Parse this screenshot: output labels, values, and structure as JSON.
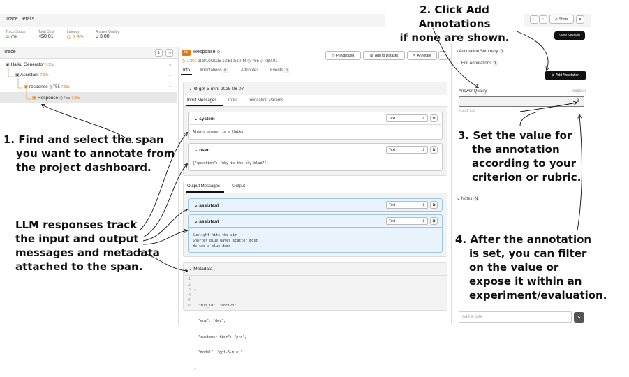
{
  "header": {
    "title": "Trace Details",
    "view_session": "View Session",
    "share": "Share",
    "metrics": [
      {
        "label": "Trace Status",
        "value": "OK"
      },
      {
        "label": "Total Cost",
        "value": "<$0.01"
      },
      {
        "label": "Latency",
        "value": "7.95s"
      },
      {
        "label": "Answer Quality",
        "value": "μ 3.00"
      }
    ]
  },
  "trace": {
    "title": "Trace",
    "nodes": [
      {
        "label": "Haiku Generator",
        "time": "7.95s"
      },
      {
        "label": "Assistant",
        "time": "7.94s"
      },
      {
        "label": "response",
        "tokens": "755",
        "time": "7.93s"
      },
      {
        "label": "Response",
        "tokens": "755",
        "time": "7.30s"
      }
    ]
  },
  "detail": {
    "kind": "llm",
    "title": "Response",
    "time": "7.30s",
    "date": "at 8/10/2025 12:51:51 PM",
    "tokens": "755",
    "cost": "<$0.01",
    "buttons": {
      "playground": "Playground",
      "dataset": "Add to Dataset",
      "annotate": "Annotate"
    },
    "tabs": [
      {
        "label": "Info"
      },
      {
        "label": "Annotations",
        "count": "0"
      },
      {
        "label": "Attributes"
      },
      {
        "label": "Events",
        "count": "0"
      }
    ],
    "model": "gpt-5-mini-2025-08-07",
    "input_tabs": [
      "Input Messages",
      "Input",
      "Invocation Params"
    ],
    "input_messages": [
      {
        "role": "system",
        "format": "Text",
        "content": "Always answer in a Haiku"
      },
      {
        "role": "user",
        "format": "Text",
        "content": "{\"question\": \"why is the sky blue?\"}"
      }
    ],
    "output_tabs": [
      "Output Messages",
      "Output"
    ],
    "output_messages": [
      {
        "role": "assistant",
        "format": "Text"
      },
      {
        "role": "assistant",
        "format": "Text",
        "lines": [
          "Sunlight hits the air",
          "Shorter blue waves scatter most",
          "We see a blue dome"
        ]
      }
    ],
    "metadata_title": "Metadata",
    "metadata_lines": [
      "{",
      "  \"run_id\": \"abc123\",",
      "  \"env\": \"dev\",",
      "  \"customer_tier\": \"pro\",",
      "  \"model\": \"gpt-5-mini\"",
      "}"
    ],
    "metadata_line_numbers": [
      "1",
      "2",
      "3",
      "4",
      "5",
      "6"
    ]
  },
  "annotations_panel": {
    "summary": "Annotation Summary",
    "summary_count": "0",
    "edit": "Edit Annotations",
    "edit_count": "1",
    "add_button": "Add Annotation",
    "field_label": "Answer Quality",
    "field_explain": "explain",
    "field_value": "3",
    "field_range": "from 1 to 3",
    "notes": "Notes",
    "notes_count": "N",
    "note_placeholder": "Add a note"
  },
  "callouts": {
    "c1": [
      "1. Find and select the span",
      "you want to annotate from",
      "the project dashboard."
    ],
    "c_llm": [
      "LLM responses track",
      "the input and output",
      "messages and metadata",
      "attached to the span."
    ],
    "c2": [
      "2. Click Add Annotations",
      "if none are shown."
    ],
    "c3": [
      "3. Set the value for",
      "the annotation",
      "according to your",
      "criterion or rubric."
    ],
    "c4": [
      "4. After the annotation",
      "is set, you can filter",
      "on the value or",
      "expose it within an",
      "experiment/evaluation."
    ]
  }
}
